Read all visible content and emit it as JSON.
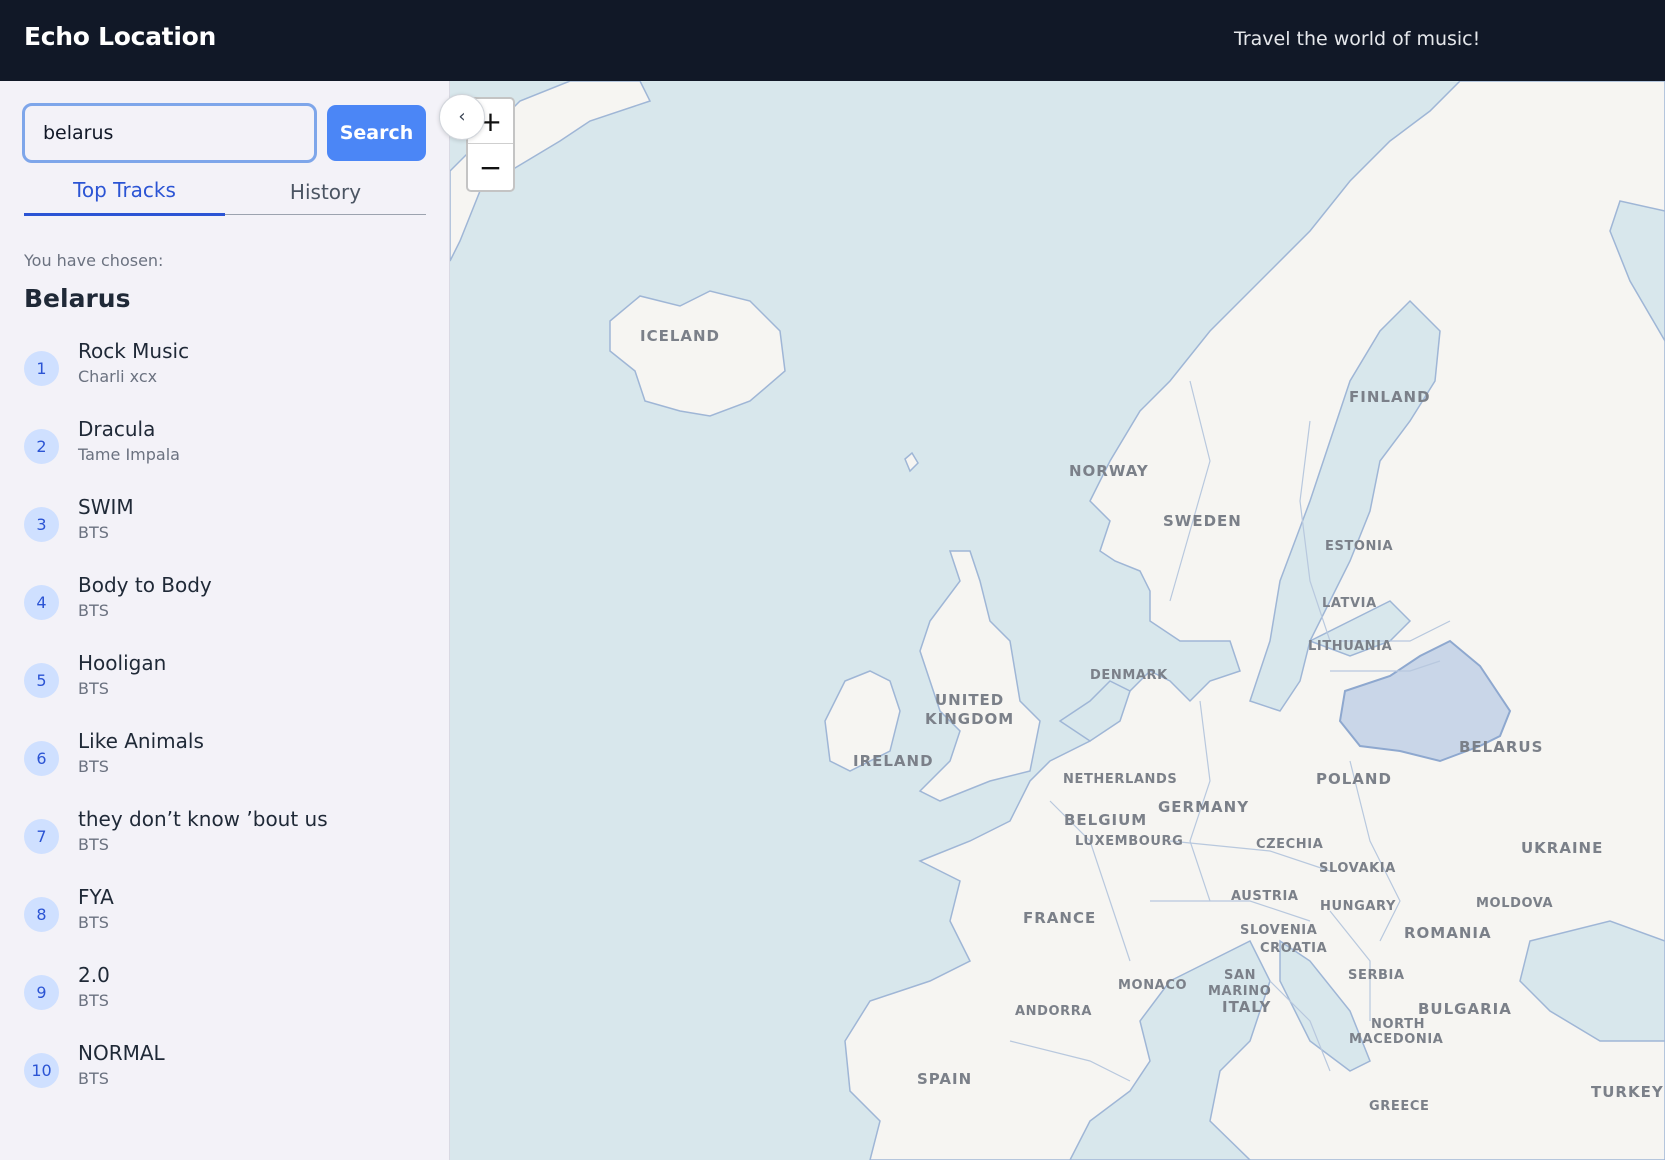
{
  "header": {
    "title": "Echo Location",
    "tagline": "Travel the world of music!"
  },
  "search": {
    "value": "belarus",
    "button_label": "Search"
  },
  "tabs": [
    {
      "label": "Top Tracks",
      "active": true
    },
    {
      "label": "History",
      "active": false
    }
  ],
  "selection": {
    "prompt": "You have chosen:",
    "country": "Belarus"
  },
  "tracks": [
    {
      "rank": "1",
      "title": "Rock Music",
      "artist": "Charli xcx"
    },
    {
      "rank": "2",
      "title": "Dracula",
      "artist": "Tame Impala"
    },
    {
      "rank": "3",
      "title": "SWIM",
      "artist": "BTS"
    },
    {
      "rank": "4",
      "title": "Body to Body",
      "artist": "BTS"
    },
    {
      "rank": "5",
      "title": "Hooligan",
      "artist": "BTS"
    },
    {
      "rank": "6",
      "title": "Like Animals",
      "artist": "BTS"
    },
    {
      "rank": "7",
      "title": "they don’t know ’bout us",
      "artist": "BTS"
    },
    {
      "rank": "8",
      "title": "FYA",
      "artist": "BTS"
    },
    {
      "rank": "9",
      "title": "2.0",
      "artist": "BTS"
    },
    {
      "rank": "10",
      "title": "NORMAL",
      "artist": "BTS"
    }
  ],
  "map": {
    "zoom_in": "+",
    "zoom_out": "−",
    "collapse_icon": "‹",
    "highlight_color": "#c9d6e8",
    "labels": {
      "iceland": "ICELAND",
      "norway": "NORWAY",
      "sweden": "SWEDEN",
      "finland": "FINLAND",
      "estonia": "ESTONIA",
      "latvia": "LATVIA",
      "lithuania": "LITHUANIA",
      "denmark": "DENMARK",
      "united": "UNITED",
      "kingdom": "KINGDOM",
      "ireland": "IRELAND",
      "netherlands": "NETHERLANDS",
      "belgium": "BELGIUM",
      "luxembourg": "LUXEMBOURG",
      "germany": "GERMANY",
      "poland": "POLAND",
      "belarus": "BELARUS",
      "ukraine": "UKRAINE",
      "czechia": "CZECHIA",
      "slovakia": "SLOVAKIA",
      "austria": "AUSTRIA",
      "hungary": "HUNGARY",
      "moldova": "MOLDOVA",
      "france": "FRANCE",
      "slovenia": "SLOVENIA",
      "croatia": "CROATIA",
      "romania": "ROMANIA",
      "san": "SAN",
      "marino": "MARINO",
      "monaco": "MONACO",
      "serbia": "SERBIA",
      "andorra": "ANDORRA",
      "italy": "ITALY",
      "bulgaria": "BULGARIA",
      "north": "NORTH",
      "macedonia": "MACEDONIA",
      "spain": "SPAIN",
      "greece": "GREECE",
      "turkey": "TURKEY"
    }
  }
}
